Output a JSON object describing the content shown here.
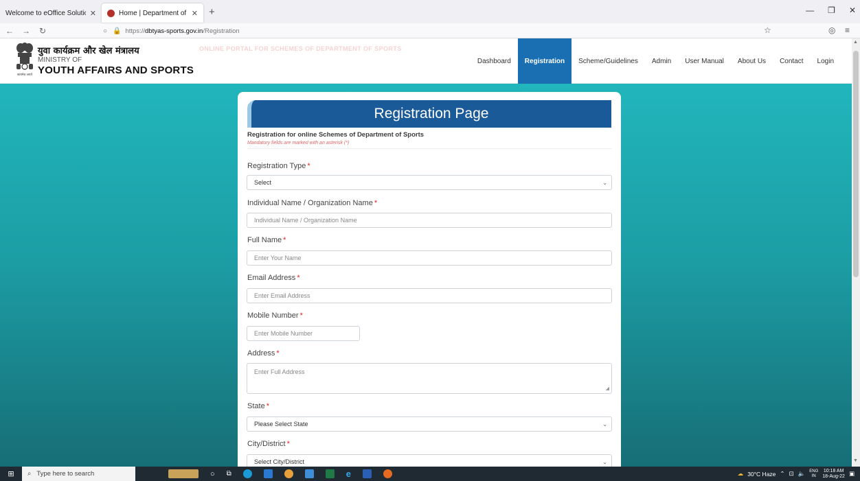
{
  "browser": {
    "tabs": [
      {
        "title": "Welcome to eOffice Solution",
        "active": false
      },
      {
        "title": "Home | Department of Sports",
        "active": true
      }
    ],
    "url": {
      "scheme": "https://",
      "host": "dbtyas-sports.gov.in",
      "path": "/Registration"
    }
  },
  "header": {
    "ministry_hindi": "युवा कार्यक्रम और खेल मंत्रालय",
    "ministry_of": "MINISTRY OF",
    "ministry_name": "YOUTH AFFAIRS AND SPORTS",
    "emblem_caption": "सत्यमेव जयते",
    "portal_banner": "ONLINE PORTAL FOR SCHEMES OF DEPARTMENT OF SPORTS",
    "menu": [
      "Dashboard",
      "Registration",
      "Scheme/Guidelines",
      "Admin",
      "User Manual",
      "About Us",
      "Contact",
      "Login"
    ],
    "active_menu": "Registration"
  },
  "form": {
    "title": "Registration Page",
    "subtitle": "Registration for online Schemes of Department of Sports",
    "mandatory_note": "Mandatory fields are marked with an asterisk (*)",
    "fields": {
      "registration_type": {
        "label": "Registration Type",
        "required": "*",
        "value": "Select"
      },
      "org_name": {
        "label": "Individual Name / Organization Name",
        "required": "*",
        "placeholder": "Individual Name / Organization Name"
      },
      "full_name": {
        "label": "Full Name",
        "required": "*",
        "placeholder": "Enter Your Name"
      },
      "email": {
        "label": "Email Address",
        "required": "*",
        "placeholder": "Enter Email Address"
      },
      "mobile": {
        "label": "Mobile Number",
        "required": "*",
        "placeholder": "Enter Mobile Number"
      },
      "address": {
        "label": "Address",
        "required": "*",
        "placeholder": "Enter Full Address"
      },
      "state": {
        "label": "State",
        "required": "*",
        "value": "Please Select State"
      },
      "city": {
        "label": "City/District",
        "required": "*",
        "value": "Select City/District"
      }
    }
  },
  "taskbar": {
    "search_placeholder": "Type here to search",
    "weather": "30°C Haze",
    "lang_top": "ENG",
    "lang_bottom": "IN",
    "time": "10:18 AM",
    "date": "18-Aug-22"
  },
  "colors": {
    "active_menu": "#1a6fb3",
    "banner": "#1a5a98",
    "gradient_top": "#21b6bc",
    "gradient_bottom": "#176e76",
    "required": "#e02020"
  }
}
